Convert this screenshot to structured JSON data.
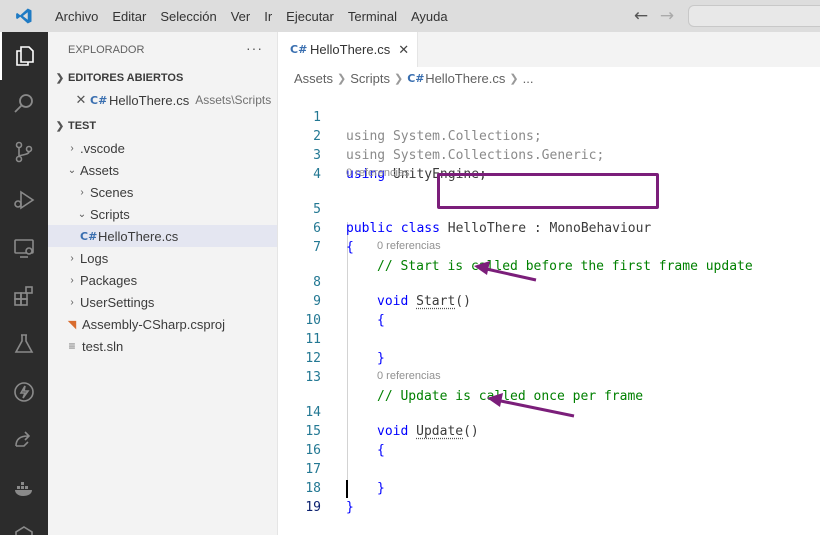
{
  "menu": [
    "Archivo",
    "Editar",
    "Selección",
    "Ver",
    "Ir",
    "Ejecutar",
    "Terminal",
    "Ayuda"
  ],
  "nav": {
    "back_icon": "arrow-left-icon",
    "forward_icon": "arrow-right-icon"
  },
  "explorer": {
    "title": "EXPLORADOR",
    "open_editors_header": "EDITORES ABIERTOS",
    "open_editor": {
      "name": "HelloThere.cs",
      "path": "Assets\\Scripts"
    },
    "folder_header": "TEST",
    "tree": {
      "vscode": ".vscode",
      "assets": "Assets",
      "scenes": "Scenes",
      "scripts": "Scripts",
      "hellothere": "HelloThere.cs",
      "logs": "Logs",
      "packages": "Packages",
      "usersettings": "UserSettings",
      "csproj": "Assembly-CSharp.csproj",
      "sln": "test.sln"
    }
  },
  "tab": {
    "label": "HelloThere.cs"
  },
  "breadcrumb": {
    "assets": "Assets",
    "scripts": "Scripts",
    "file": "HelloThere.cs",
    "more": "..."
  },
  "code": {
    "line_numbers": [
      "1",
      "2",
      "3",
      "4",
      "5",
      "6",
      "7",
      "8",
      "9",
      "10",
      "11",
      "12",
      "13",
      "14",
      "15",
      "16",
      "17",
      "18",
      "19"
    ],
    "l1_kw": "using",
    "l1_rest": " System.Collections;",
    "l2_kw": "using",
    "l2_rest": " System.Collections.Generic;",
    "l3_kw": "using",
    "l3_rest": " UnityEngine;",
    "lens_class": "0 referencias",
    "l5_kw": "public class",
    "l5_name": "HelloThere",
    "l5_sep": " : ",
    "l5_base": "MonoBehaviour",
    "l6": "{",
    "l7_comment": "// Start is called before the first frame update",
    "lens_start": "0 referencias",
    "l8_kw": "void",
    "l8_name": "Start",
    "l8_parens": "()",
    "l9": "{",
    "l11": "}",
    "l13_comment": "// Update is called once per frame",
    "lens_update": "0 referencias",
    "l14_kw": "void",
    "l14_name": "Update",
    "l14_parens": "()",
    "l15": "{",
    "l17": "}",
    "l18": "}"
  },
  "annotation_color": "#7b1e7a",
  "colors": {
    "activitybar": "#2c2c2c",
    "keyword": "#0000ff",
    "comment": "#008000",
    "line_number": "#237893"
  }
}
